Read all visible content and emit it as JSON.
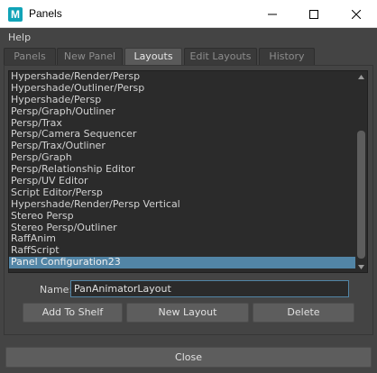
{
  "window": {
    "title": "Panels",
    "app_icon_letter": "M",
    "accent_color": "#10a3b7"
  },
  "menu": {
    "items": [
      "Help"
    ]
  },
  "tabs": [
    {
      "label": "Panels",
      "active": false
    },
    {
      "label": "New Panel",
      "active": false
    },
    {
      "label": "Layouts",
      "active": true
    },
    {
      "label": "Edit Layouts",
      "active": false
    },
    {
      "label": "History",
      "active": false
    }
  ],
  "layouts": {
    "items": [
      "Hypershade/Render/Persp",
      "Hypershade/Outliner/Persp",
      "Hypershade/Persp",
      "Persp/Graph/Outliner",
      "Persp/Trax",
      "Persp/Camera Sequencer",
      "Persp/Trax/Outliner",
      "Persp/Graph",
      "Persp/Relationship Editor",
      "Persp/UV Editor",
      "Script Editor/Persp",
      "Hypershade/Render/Persp Vertical",
      "Stereo Persp",
      "Stereo Persp/Outliner",
      "RaffAnim",
      "RaffScript",
      "Panel Configuration23"
    ],
    "selected_index": 16,
    "selection_color": "#5285a6"
  },
  "name_field": {
    "label": "Name:",
    "value": "PanAnimatorLayout"
  },
  "buttons": {
    "add_to_shelf": "Add To Shelf",
    "new_layout": "New Layout",
    "delete": "Delete",
    "close": "Close"
  },
  "icons": {
    "minimize": "minimize-icon",
    "maximize": "maximize-icon",
    "close": "close-icon",
    "scroll_up": "chevron-up-icon",
    "scroll_down": "chevron-down-icon"
  }
}
